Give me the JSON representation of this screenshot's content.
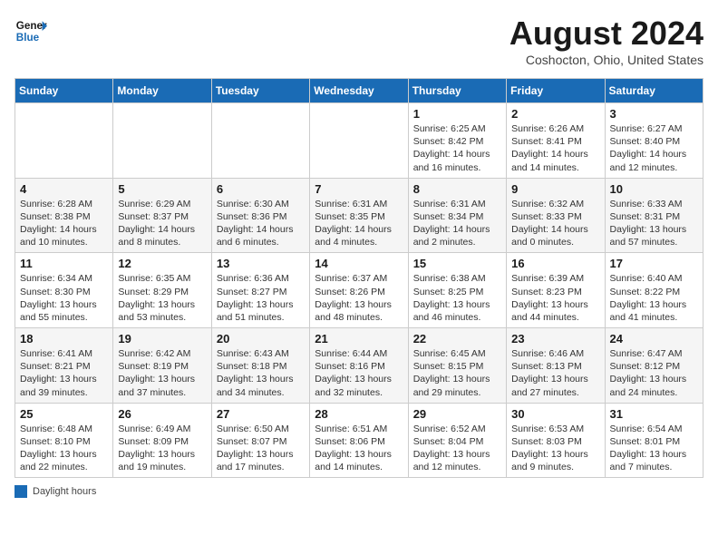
{
  "header": {
    "logo_line1": "General",
    "logo_line2": "Blue",
    "month_year": "August 2024",
    "location": "Coshocton, Ohio, United States"
  },
  "days_of_week": [
    "Sunday",
    "Monday",
    "Tuesday",
    "Wednesday",
    "Thursday",
    "Friday",
    "Saturday"
  ],
  "legend_label": "Daylight hours",
  "weeks": [
    [
      {
        "day": "",
        "info": ""
      },
      {
        "day": "",
        "info": ""
      },
      {
        "day": "",
        "info": ""
      },
      {
        "day": "",
        "info": ""
      },
      {
        "day": "1",
        "info": "Sunrise: 6:25 AM\nSunset: 8:42 PM\nDaylight: 14 hours and 16 minutes."
      },
      {
        "day": "2",
        "info": "Sunrise: 6:26 AM\nSunset: 8:41 PM\nDaylight: 14 hours and 14 minutes."
      },
      {
        "day": "3",
        "info": "Sunrise: 6:27 AM\nSunset: 8:40 PM\nDaylight: 14 hours and 12 minutes."
      }
    ],
    [
      {
        "day": "4",
        "info": "Sunrise: 6:28 AM\nSunset: 8:38 PM\nDaylight: 14 hours and 10 minutes."
      },
      {
        "day": "5",
        "info": "Sunrise: 6:29 AM\nSunset: 8:37 PM\nDaylight: 14 hours and 8 minutes."
      },
      {
        "day": "6",
        "info": "Sunrise: 6:30 AM\nSunset: 8:36 PM\nDaylight: 14 hours and 6 minutes."
      },
      {
        "day": "7",
        "info": "Sunrise: 6:31 AM\nSunset: 8:35 PM\nDaylight: 14 hours and 4 minutes."
      },
      {
        "day": "8",
        "info": "Sunrise: 6:31 AM\nSunset: 8:34 PM\nDaylight: 14 hours and 2 minutes."
      },
      {
        "day": "9",
        "info": "Sunrise: 6:32 AM\nSunset: 8:33 PM\nDaylight: 14 hours and 0 minutes."
      },
      {
        "day": "10",
        "info": "Sunrise: 6:33 AM\nSunset: 8:31 PM\nDaylight: 13 hours and 57 minutes."
      }
    ],
    [
      {
        "day": "11",
        "info": "Sunrise: 6:34 AM\nSunset: 8:30 PM\nDaylight: 13 hours and 55 minutes."
      },
      {
        "day": "12",
        "info": "Sunrise: 6:35 AM\nSunset: 8:29 PM\nDaylight: 13 hours and 53 minutes."
      },
      {
        "day": "13",
        "info": "Sunrise: 6:36 AM\nSunset: 8:27 PM\nDaylight: 13 hours and 51 minutes."
      },
      {
        "day": "14",
        "info": "Sunrise: 6:37 AM\nSunset: 8:26 PM\nDaylight: 13 hours and 48 minutes."
      },
      {
        "day": "15",
        "info": "Sunrise: 6:38 AM\nSunset: 8:25 PM\nDaylight: 13 hours and 46 minutes."
      },
      {
        "day": "16",
        "info": "Sunrise: 6:39 AM\nSunset: 8:23 PM\nDaylight: 13 hours and 44 minutes."
      },
      {
        "day": "17",
        "info": "Sunrise: 6:40 AM\nSunset: 8:22 PM\nDaylight: 13 hours and 41 minutes."
      }
    ],
    [
      {
        "day": "18",
        "info": "Sunrise: 6:41 AM\nSunset: 8:21 PM\nDaylight: 13 hours and 39 minutes."
      },
      {
        "day": "19",
        "info": "Sunrise: 6:42 AM\nSunset: 8:19 PM\nDaylight: 13 hours and 37 minutes."
      },
      {
        "day": "20",
        "info": "Sunrise: 6:43 AM\nSunset: 8:18 PM\nDaylight: 13 hours and 34 minutes."
      },
      {
        "day": "21",
        "info": "Sunrise: 6:44 AM\nSunset: 8:16 PM\nDaylight: 13 hours and 32 minutes."
      },
      {
        "day": "22",
        "info": "Sunrise: 6:45 AM\nSunset: 8:15 PM\nDaylight: 13 hours and 29 minutes."
      },
      {
        "day": "23",
        "info": "Sunrise: 6:46 AM\nSunset: 8:13 PM\nDaylight: 13 hours and 27 minutes."
      },
      {
        "day": "24",
        "info": "Sunrise: 6:47 AM\nSunset: 8:12 PM\nDaylight: 13 hours and 24 minutes."
      }
    ],
    [
      {
        "day": "25",
        "info": "Sunrise: 6:48 AM\nSunset: 8:10 PM\nDaylight: 13 hours and 22 minutes."
      },
      {
        "day": "26",
        "info": "Sunrise: 6:49 AM\nSunset: 8:09 PM\nDaylight: 13 hours and 19 minutes."
      },
      {
        "day": "27",
        "info": "Sunrise: 6:50 AM\nSunset: 8:07 PM\nDaylight: 13 hours and 17 minutes."
      },
      {
        "day": "28",
        "info": "Sunrise: 6:51 AM\nSunset: 8:06 PM\nDaylight: 13 hours and 14 minutes."
      },
      {
        "day": "29",
        "info": "Sunrise: 6:52 AM\nSunset: 8:04 PM\nDaylight: 13 hours and 12 minutes."
      },
      {
        "day": "30",
        "info": "Sunrise: 6:53 AM\nSunset: 8:03 PM\nDaylight: 13 hours and 9 minutes."
      },
      {
        "day": "31",
        "info": "Sunrise: 6:54 AM\nSunset: 8:01 PM\nDaylight: 13 hours and 7 minutes."
      }
    ]
  ]
}
